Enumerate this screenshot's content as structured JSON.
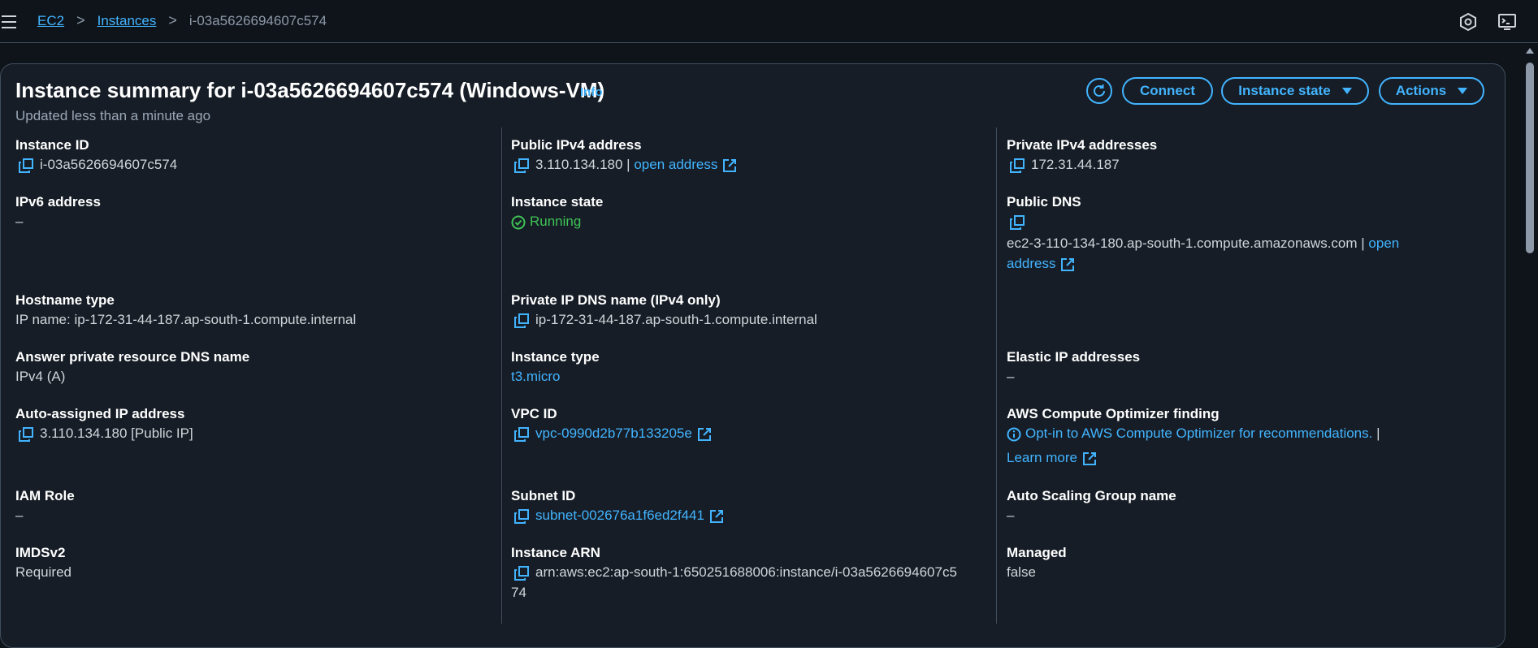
{
  "breadcrumb": {
    "ec2": "EC2",
    "instances": "Instances",
    "current": "i-03a5626694607c574",
    "sep": ">"
  },
  "summary": {
    "title": "Instance summary for i-03a5626694607c574 (Windows-VM)",
    "info": "Info",
    "updated": "Updated less than a minute ago"
  },
  "buttons": {
    "connect": "Connect",
    "instance_state": "Instance state",
    "actions": "Actions"
  },
  "fields": {
    "instance_id": {
      "label": "Instance ID",
      "value": "i-03a5626694607c574"
    },
    "public_ipv4": {
      "label": "Public IPv4 address",
      "value": "3.110.134.180 |",
      "link": "open address"
    },
    "private_ipv4": {
      "label": "Private IPv4 addresses",
      "value": "172.31.44.187"
    },
    "ipv6": {
      "label": "IPv6 address",
      "value": "–"
    },
    "instance_state": {
      "label": "Instance state",
      "value": "Running"
    },
    "public_dns": {
      "label": "Public DNS",
      "value": "ec2-3-110-134-180.ap-south-1.compute.amazonaws.com |",
      "link1": "open",
      "link2": "address"
    },
    "hostname_type": {
      "label": "Hostname type",
      "value": "IP name: ip-172-31-44-187.ap-south-1.compute.internal"
    },
    "private_ip_dns": {
      "label": "Private IP DNS name (IPv4 only)",
      "value": "ip-172-31-44-187.ap-south-1.compute.internal"
    },
    "answer_dns": {
      "label": "Answer private resource DNS name",
      "value": "IPv4 (A)"
    },
    "instance_type": {
      "label": "Instance type",
      "value": "t3.micro"
    },
    "elastic_ip": {
      "label": "Elastic IP addresses",
      "value": "–"
    },
    "auto_ip": {
      "label": "Auto-assigned IP address",
      "value": "3.110.134.180 [Public IP]"
    },
    "vpc_id": {
      "label": "VPC ID",
      "value": "vpc-0990d2b77b133205e"
    },
    "optimizer": {
      "label": "AWS Compute Optimizer finding",
      "link": "Opt-in to AWS Compute Optimizer for recommendations.",
      "sep": "|",
      "learn": "Learn more"
    },
    "iam_role": {
      "label": "IAM Role",
      "value": "–"
    },
    "subnet_id": {
      "label": "Subnet ID",
      "value": "subnet-002676a1f6ed2f441"
    },
    "asg_name": {
      "label": "Auto Scaling Group name",
      "value": "–"
    },
    "imdsv2": {
      "label": "IMDSv2",
      "value": "Required"
    },
    "instance_arn": {
      "label": "Instance ARN",
      "value1": "arn:aws:ec2:ap-south-1:650251688006:instance/i-03a5626694607c5",
      "value2": "74"
    },
    "managed": {
      "label": "Managed",
      "value": "false"
    }
  },
  "icons": {
    "menu": "hamburger-menu-icon",
    "settings": "hexagon-settings-icon",
    "cloudshell": "cloudshell-icon",
    "refresh": "refresh-icon",
    "copy": "copy-icon",
    "external": "external-link-icon",
    "status": "check-circle-icon",
    "info": "info-circle-icon"
  },
  "colors": {
    "link": "#42b4ff",
    "success": "#3fc356",
    "background": "#0f141a",
    "panel": "#161d26"
  }
}
